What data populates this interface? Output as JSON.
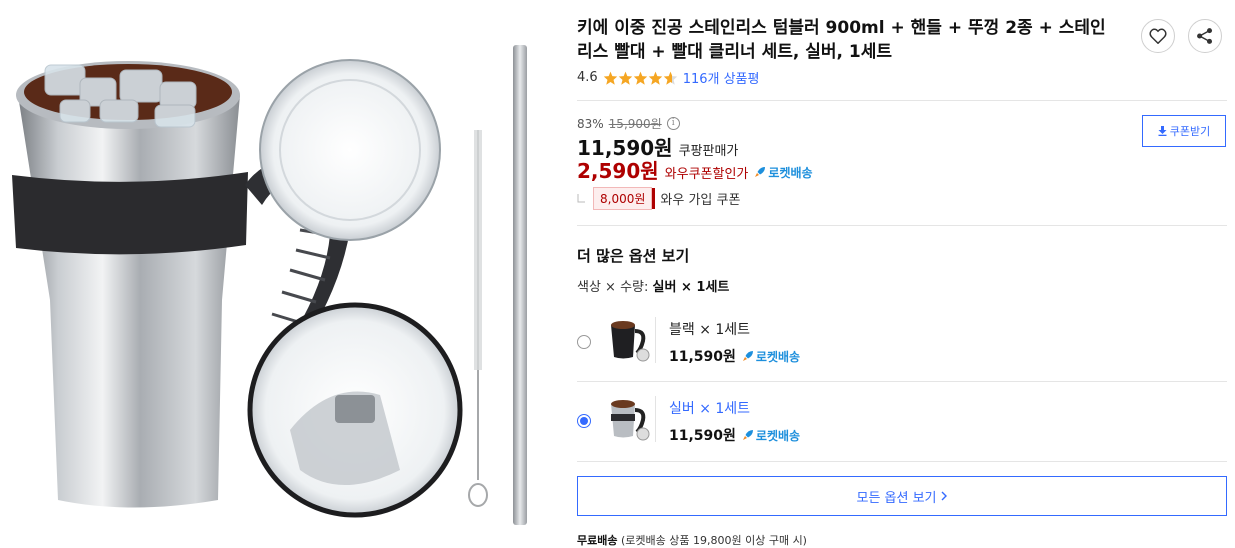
{
  "product": {
    "title": "키에 이중 진공 스테인리스 텀블러 900ml + 핸들 + 뚜껑 2종 + 스테인리스 빨대 + 빨대 클리너 세트, 실버, 1세트",
    "rating": "4.6",
    "rating_stars_value": 4.6,
    "review_count": "116개 상품평"
  },
  "price": {
    "discount_rate": "83%",
    "original_price": "15,900원",
    "sale_price": "11,590원",
    "sale_label": "쿠팡판매가",
    "wow_price": "2,590원",
    "wow_label": "와우쿠폰할인가",
    "rocket_label": "로켓배송",
    "coupon_amount": "8,000원",
    "coupon_label": "와우 가입 쿠폰",
    "coupon_button": "쿠폰받기",
    "info_symbol": "i"
  },
  "options": {
    "section_title": "더 많은 옵션 보기",
    "label_prefix": "색상 × 수량:",
    "label_value": "실버 × 1세트",
    "items": [
      {
        "name": "블랙 × 1세트",
        "price": "11,590원",
        "delivery": "로켓배송",
        "selected": false
      },
      {
        "name": "실버 × 1세트",
        "price": "11,590원",
        "delivery": "로켓배송",
        "selected": true
      }
    ],
    "all_button": "모든 옵션 보기"
  },
  "shipping": {
    "label": "무료배송",
    "condition": "(로켓배송 상품 19,800원 이상 구매 시)"
  },
  "colors": {
    "accent_blue": "#346aff",
    "wow_red": "#ae0000",
    "star_orange": "#f5a623",
    "rocket_blue": "#1d8fdc"
  },
  "icons": [
    "heart-icon",
    "share-icon",
    "star-icon",
    "info-icon",
    "download-icon",
    "rocket-icon",
    "chevron-right-icon"
  ]
}
